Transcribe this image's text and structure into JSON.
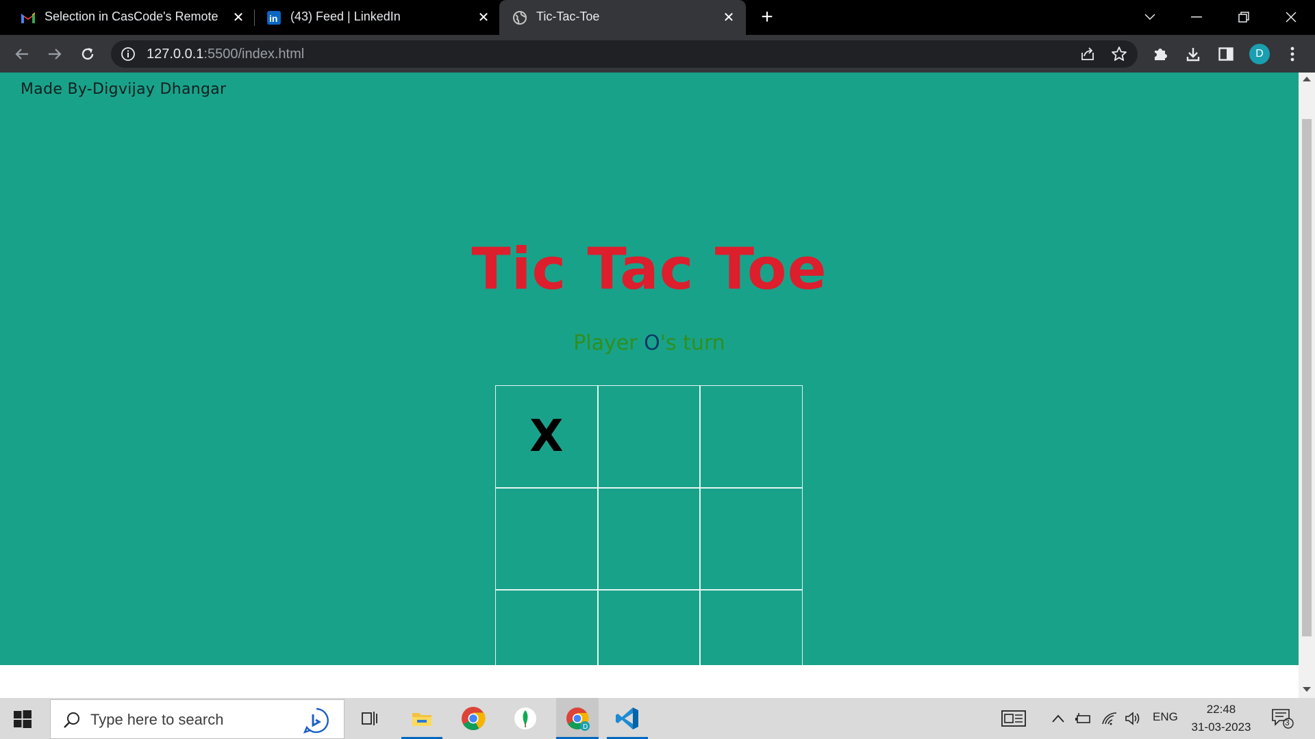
{
  "browser": {
    "tabs": [
      {
        "title": "Selection in CasCode's Remote In",
        "icon": "gmail-icon",
        "active": false
      },
      {
        "title": "(43) Feed | LinkedIn",
        "icon": "linkedin-icon",
        "active": false
      },
      {
        "title": "Tic-Tac-Toe",
        "icon": "globe-icon",
        "active": true
      }
    ],
    "new_tab": "+",
    "url_host": "127.0.0.1",
    "url_rest": ":5500/index.html",
    "profile_initial": "D"
  },
  "page": {
    "credit": "Made By-Digvijay Dhangar",
    "title": "Tic Tac Toe",
    "turn_prefix": "Player ",
    "turn_player": "O",
    "turn_suffix": "'s turn",
    "board": [
      "X",
      "",
      "",
      "",
      "",
      "",
      "",
      "",
      ""
    ],
    "colors": {
      "background": "#19a28a",
      "title": "#dc1e2d",
      "turn_text": "#2f8f1f",
      "turn_player": "#0b3a66"
    }
  },
  "taskbar": {
    "search_placeholder": "Type here to search",
    "language": "ENG",
    "time": "22:48",
    "date": "31-03-2023",
    "notifications": "3"
  }
}
